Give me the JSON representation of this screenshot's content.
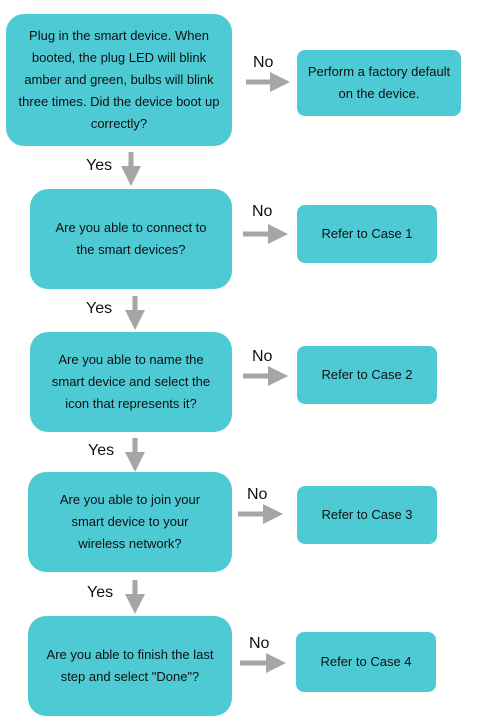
{
  "colors": {
    "box_fill": "#4ecad4",
    "arrow": "#a6a6a6",
    "text": "#111111"
  },
  "questions": [
    {
      "text": "Plug in the smart device. When booted, the plug LED will blink amber and green, bulbs will blink three times. Did the device boot up correctly?"
    },
    {
      "text": "Are you able to connect to the smart devices?"
    },
    {
      "text": "Are you able to name the smart device and select the icon that represents it?"
    },
    {
      "text": "Are you able to join your smart device to your wireless network?"
    },
    {
      "text": "Are you able to finish the last step and select \"Done\"?"
    }
  ],
  "outcomes": [
    {
      "text": "Perform a factory default on the device."
    },
    {
      "text": "Refer to Case 1"
    },
    {
      "text": "Refer to Case 2"
    },
    {
      "text": "Refer to Case 3"
    },
    {
      "text": "Refer to Case 4"
    }
  ],
  "labels": {
    "yes": "Yes",
    "no": "No"
  }
}
